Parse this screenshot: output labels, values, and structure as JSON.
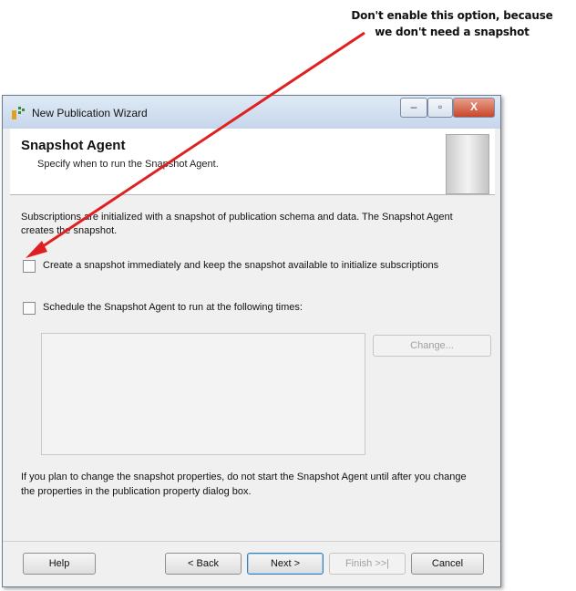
{
  "annotation": {
    "line1": "Don't enable this option, because",
    "line2": "we don't need a snapshot"
  },
  "window": {
    "title": "New Publication Wizard",
    "controls": {
      "minimize": "–",
      "maximize": "▫",
      "close": "X"
    }
  },
  "header": {
    "title": "Snapshot Agent",
    "subtitle": "Specify when to run the Snapshot Agent."
  },
  "content": {
    "description": "Subscriptions are initialized with a snapshot of publication schema and data. The Snapshot Agent creates the snapshot.",
    "option_create_snapshot": {
      "label": "Create a snapshot immediately and keep the snapshot available to initialize subscriptions",
      "checked": false
    },
    "option_schedule": {
      "label": "Schedule the Snapshot Agent to run at the following times:",
      "checked": false
    },
    "change_button": "Change...",
    "note": "If you plan to change the snapshot properties, do not start the Snapshot Agent until after you change the properties in the publication property dialog box."
  },
  "footer": {
    "help": "Help",
    "back": "< Back",
    "next": "Next >",
    "finish": "Finish >>|",
    "cancel": "Cancel"
  },
  "colors": {
    "arrow": "#e02020",
    "default_button_border": "#3c7fb1",
    "close_button": "#c9462a"
  }
}
